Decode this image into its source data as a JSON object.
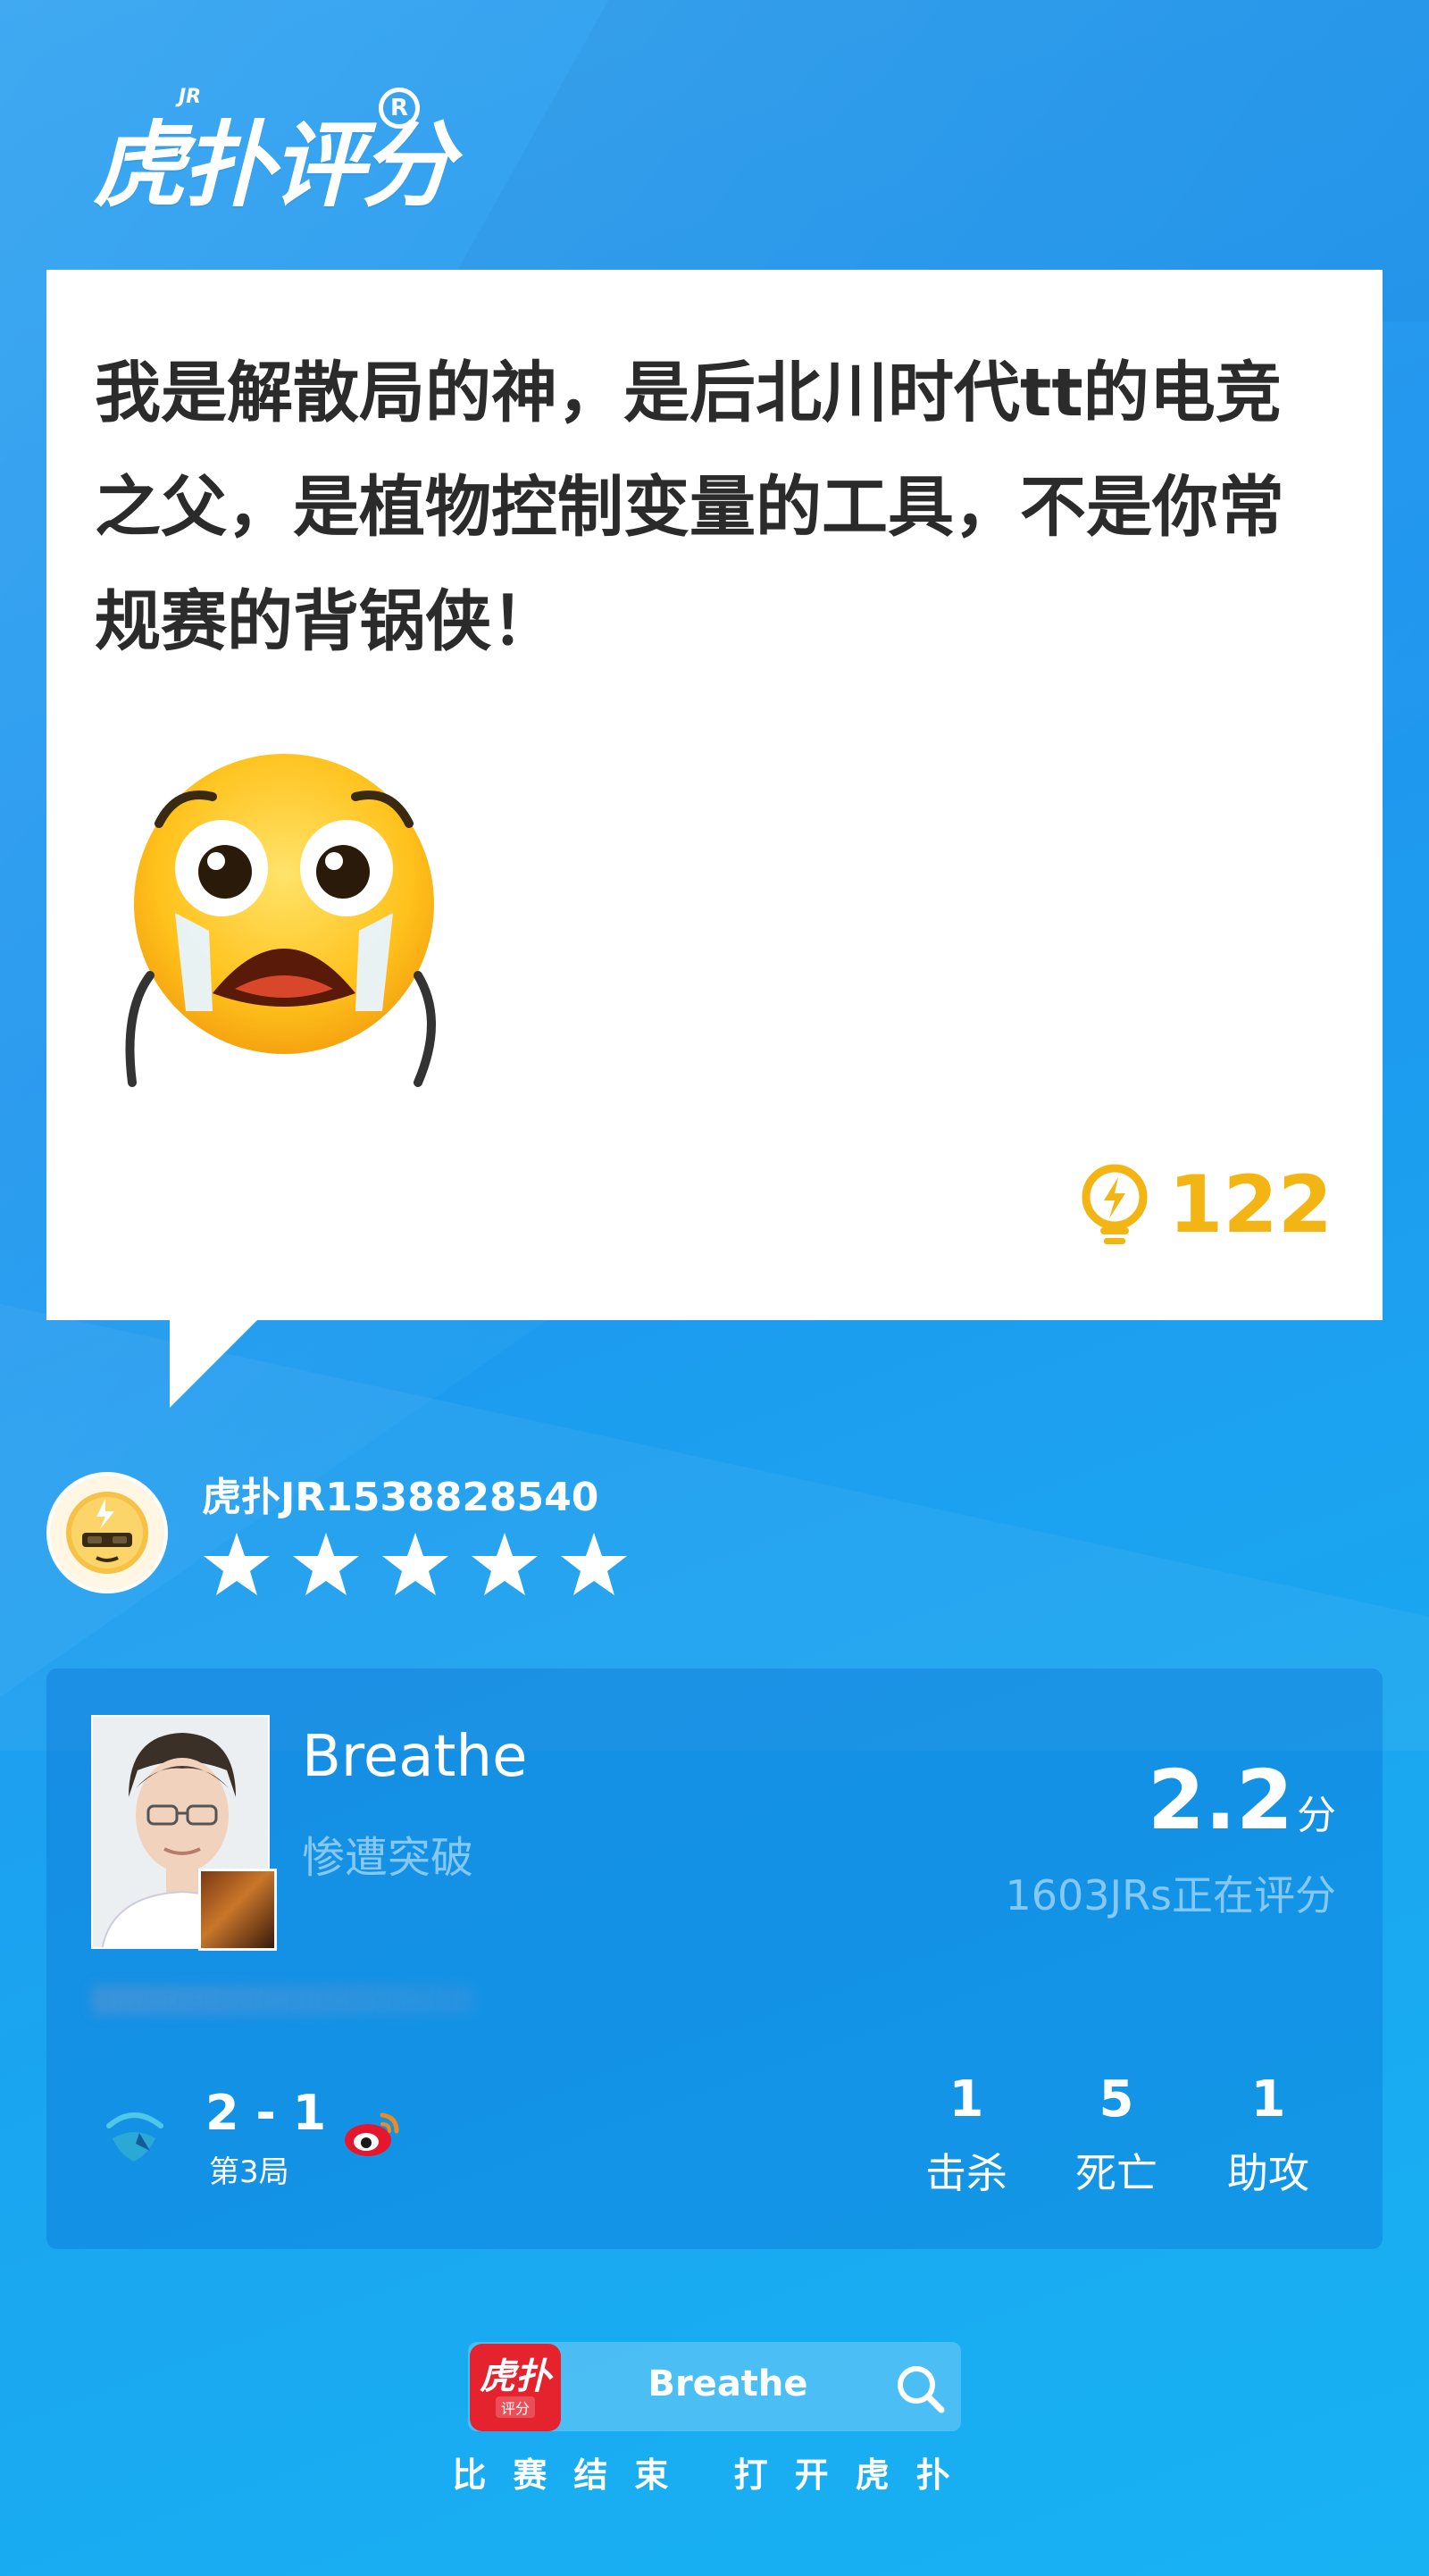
{
  "brand": {
    "logo_text": "虎扑评分",
    "logo_superscript": "JR",
    "registered_mark": "R"
  },
  "comment": {
    "text": "我是解散局的神，是后北川时代tt的电竞之父，是植物控制变量的工具，不是你常规赛的背锅侠！",
    "likes": "122",
    "emoji_icon": "crying-face-icon",
    "like_icon": "lightbulb-icon"
  },
  "user": {
    "name": "虎扑JR1538828540",
    "stars": 5,
    "avatar_icon": "sunglasses-bot-avatar-icon"
  },
  "player": {
    "name": "Breathe",
    "tag": "惨遭突破",
    "score": "2.2",
    "score_unit": "分",
    "raters": "1603JRs正在评分",
    "match_score": "2 - 1",
    "round": "第3局",
    "kills": "1",
    "deaths": "5",
    "assists": "1",
    "kills_label": "击杀",
    "deaths_label": "死亡",
    "assists_label": "助攻"
  },
  "footer": {
    "app_icon_text": "虎扑",
    "app_icon_subtext": "评分",
    "search_text": "Breathe",
    "caption": "比赛结束 打开虎扑"
  },
  "colors": {
    "background": "#1f95ee",
    "like_accent": "#f3b514",
    "app_red": "#e5232e"
  }
}
